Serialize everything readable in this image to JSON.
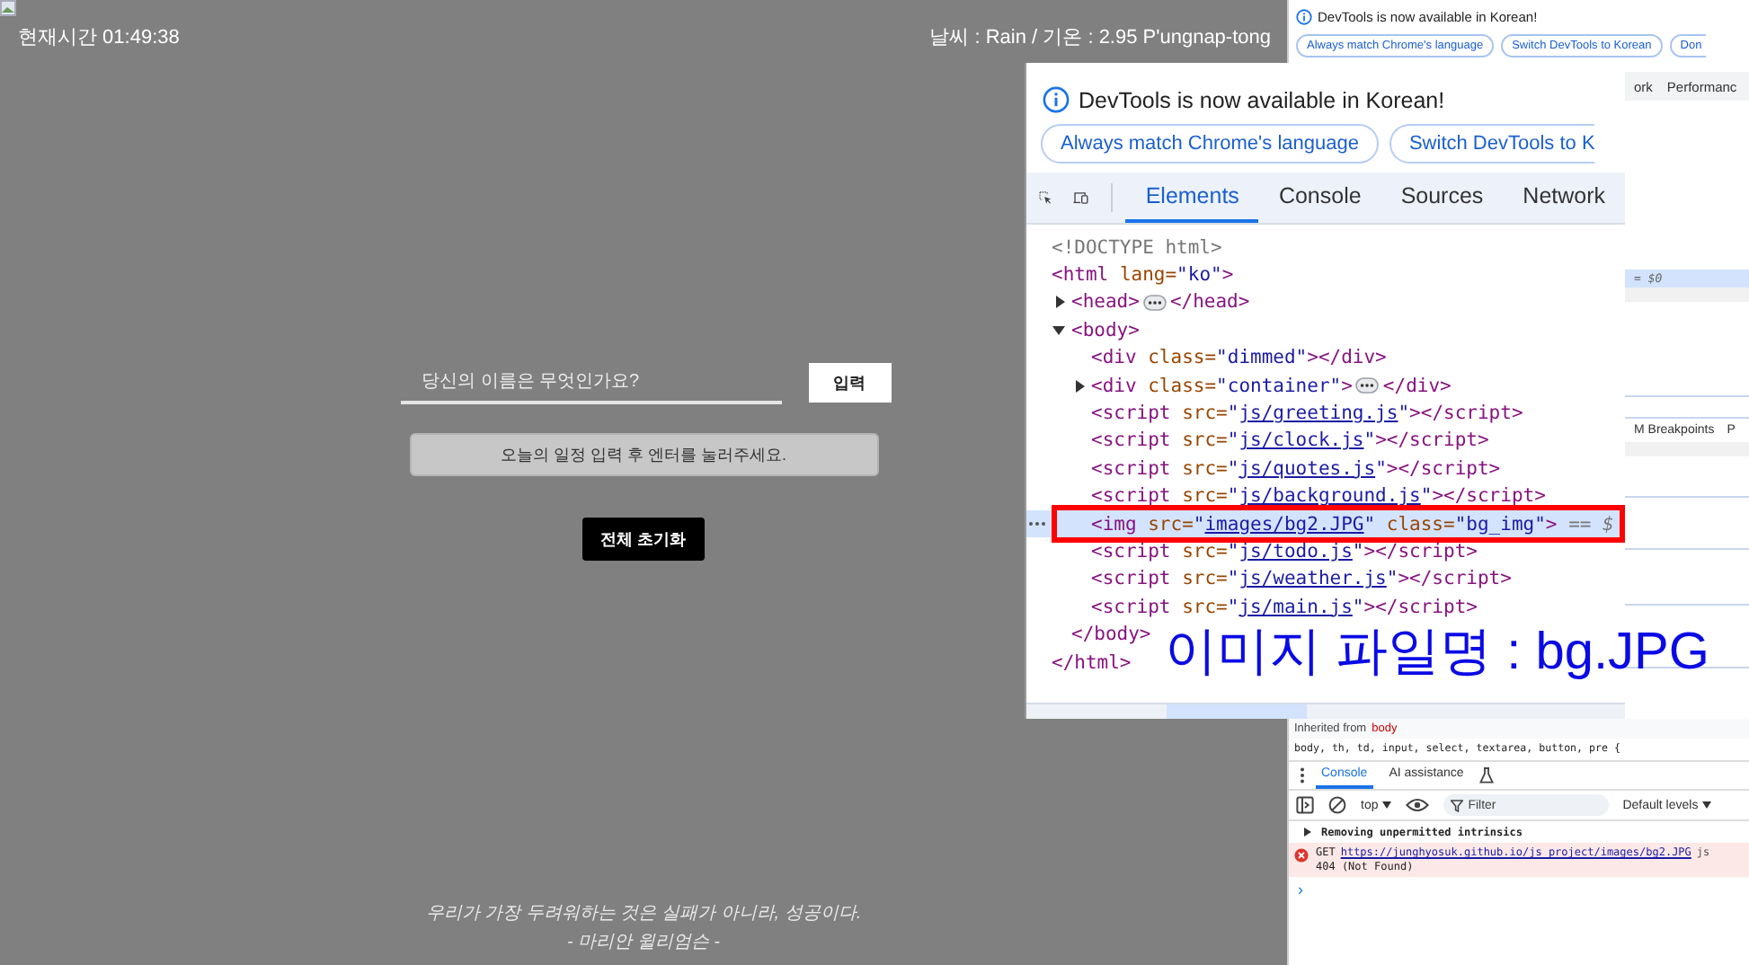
{
  "page": {
    "clock": "현재시간 01:49:38",
    "weather": "날씨 : Rain / 기온 : 2.95 P'ungnap-tong",
    "name_field": {
      "placeholder": "당신의 이름은 무엇인가요?"
    },
    "submit_button": "입력",
    "todo_field": {
      "placeholder": "오늘의 일정 입력 후 엔터를 눌러주세요."
    },
    "reset_button": "전체 초기화",
    "quote": "우리가 가장 두려워하는 것은 실패가 아니라, 성공이다.",
    "author": "- 마리안 윌리엄슨 -"
  },
  "devtools": {
    "banner": "DevTools is now available in Korean!",
    "banner_buttons": [
      "Always match Chrome's language",
      "Switch DevTools to Korean",
      "Don"
    ],
    "tabs": [
      {
        "label": "ork",
        "selected": false
      },
      {
        "label": "Performanc",
        "selected": false
      }
    ],
    "selected_row": "= $0",
    "pane_tabs": [
      "M Breakpoints",
      "P"
    ],
    "inherited_label": "Inherited from",
    "inherited_element": "body",
    "style_rule": "body, th, td, input, select, textarea, button, pre {",
    "drawer_tabs": [
      {
        "label": "Console",
        "selected": true
      },
      {
        "label": "AI assistance",
        "selected": false
      }
    ],
    "context": "top",
    "filter": {
      "placeholder": "Filter"
    },
    "levels": "Default levels",
    "messages": [
      {
        "kind": "info",
        "text": "Removing unpermitted intrinsics"
      },
      {
        "kind": "error",
        "method": "GET",
        "url": "https://junghyosuk.github.io/js_project/images/bg2.JPG",
        "source": "js",
        "status": "404 (Not Found)"
      }
    ],
    "prompt": "›"
  },
  "zoomed_devtools": {
    "banner": "DevTools is now available in Korean!",
    "banner_buttons": [
      "Always match Chrome's language",
      "Switch DevTools to K"
    ],
    "tabs": [
      {
        "label": "Elements",
        "selected": true
      },
      {
        "label": "Console",
        "selected": false
      },
      {
        "label": "Sources",
        "selected": false
      },
      {
        "label": "Network",
        "selected": false
      }
    ],
    "dom": [
      {
        "kind": "leaf",
        "selected": false,
        "tokens": [
          {
            "kind": "comment",
            "text": "<!DOCTYPE html>"
          }
        ]
      },
      {
        "kind": "leaf",
        "selected": false,
        "tokens": [
          {
            "kind": "tag",
            "text": "<html "
          },
          {
            "kind": "attr",
            "text": "lang="
          },
          {
            "kind": "value",
            "text": "\"ko\""
          },
          {
            "kind": "tag",
            "text": ">"
          }
        ],
        "end": [
          {
            "kind": "tag",
            "text": "</html>"
          }
        ],
        "children": [
          {
            "kind": "collapsed",
            "selected": false,
            "tokens": [
              {
                "kind": "tag",
                "text": "<head>"
              },
              {
                "kind": "ellipsis"
              },
              {
                "kind": "tag",
                "text": "</head>"
              }
            ]
          },
          {
            "kind": "expanded",
            "selected": false,
            "tokens": [
              {
                "kind": "tag",
                "text": "<body>"
              }
            ],
            "end": [
              {
                "kind": "tag",
                "text": "</body>"
              }
            ],
            "children": [
              {
                "kind": "leaf",
                "selected": false,
                "tokens": [
                  {
                    "kind": "tag",
                    "text": "<div "
                  },
                  {
                    "kind": "attr",
                    "text": "class="
                  },
                  {
                    "kind": "value",
                    "text": "\"dimmed\""
                  },
                  {
                    "kind": "tag",
                    "text": "></div>"
                  }
                ]
              },
              {
                "kind": "collapsed",
                "selected": false,
                "tokens": [
                  {
                    "kind": "tag",
                    "text": "<div "
                  },
                  {
                    "kind": "attr",
                    "text": "class="
                  },
                  {
                    "kind": "value",
                    "text": "\"container\""
                  },
                  {
                    "kind": "tag",
                    "text": ">"
                  },
                  {
                    "kind": "ellipsis"
                  },
                  {
                    "kind": "tag",
                    "text": "</div>"
                  }
                ]
              },
              {
                "kind": "leaf",
                "selected": false,
                "tokens": [
                  {
                    "kind": "tag",
                    "text": "<script "
                  },
                  {
                    "kind": "attr",
                    "text": "src="
                  },
                  {
                    "kind": "value",
                    "text": "\""
                  },
                  {
                    "kind": "link",
                    "text": "js/greeting.js"
                  },
                  {
                    "kind": "value",
                    "text": "\""
                  },
                  {
                    "kind": "tag",
                    "text": "></script>"
                  }
                ]
              },
              {
                "kind": "leaf",
                "selected": false,
                "tokens": [
                  {
                    "kind": "tag",
                    "text": "<script "
                  },
                  {
                    "kind": "attr",
                    "text": "src="
                  },
                  {
                    "kind": "value",
                    "text": "\""
                  },
                  {
                    "kind": "link",
                    "text": "js/clock.js"
                  },
                  {
                    "kind": "value",
                    "text": "\""
                  },
                  {
                    "kind": "tag",
                    "text": "></script>"
                  }
                ]
              },
              {
                "kind": "leaf",
                "selected": false,
                "tokens": [
                  {
                    "kind": "tag",
                    "text": "<script "
                  },
                  {
                    "kind": "attr",
                    "text": "src="
                  },
                  {
                    "kind": "value",
                    "text": "\""
                  },
                  {
                    "kind": "link",
                    "text": "js/quotes.js"
                  },
                  {
                    "kind": "value",
                    "text": "\""
                  },
                  {
                    "kind": "tag",
                    "text": "></script>"
                  }
                ]
              },
              {
                "kind": "leaf",
                "selected": false,
                "tokens": [
                  {
                    "kind": "tag",
                    "text": "<script "
                  },
                  {
                    "kind": "attr",
                    "text": "src="
                  },
                  {
                    "kind": "value",
                    "text": "\""
                  },
                  {
                    "kind": "link",
                    "text": "js/background.js"
                  },
                  {
                    "kind": "value",
                    "text": "\""
                  },
                  {
                    "kind": "tag",
                    "text": "></script>"
                  }
                ]
              },
              {
                "kind": "leaf",
                "selected": true,
                "tokens": [
                  {
                    "kind": "tag",
                    "text": "<img "
                  },
                  {
                    "kind": "attr",
                    "text": "src="
                  },
                  {
                    "kind": "value",
                    "text": "\""
                  },
                  {
                    "kind": "link",
                    "text": "images/bg2.JPG"
                  },
                  {
                    "kind": "value",
                    "text": "\""
                  },
                  {
                    "kind": "attr",
                    "text": " class="
                  },
                  {
                    "kind": "value",
                    "text": "\"bg_img\""
                  },
                  {
                    "kind": "tag",
                    "text": ">"
                  },
                  {
                    "kind": "marker",
                    "text": " == $"
                  }
                ]
              },
              {
                "kind": "leaf",
                "selected": false,
                "tokens": [
                  {
                    "kind": "tag",
                    "text": "<script "
                  },
                  {
                    "kind": "attr",
                    "text": "src="
                  },
                  {
                    "kind": "value",
                    "text": "\""
                  },
                  {
                    "kind": "link",
                    "text": "js/todo.js"
                  },
                  {
                    "kind": "value",
                    "text": "\""
                  },
                  {
                    "kind": "tag",
                    "text": "></script>"
                  }
                ]
              },
              {
                "kind": "leaf",
                "selected": false,
                "tokens": [
                  {
                    "kind": "tag",
                    "text": "<script "
                  },
                  {
                    "kind": "attr",
                    "text": "src="
                  },
                  {
                    "kind": "value",
                    "text": "\""
                  },
                  {
                    "kind": "link",
                    "text": "js/weather.js"
                  },
                  {
                    "kind": "value",
                    "text": "\""
                  },
                  {
                    "kind": "tag",
                    "text": "></script>"
                  }
                ]
              },
              {
                "kind": "leaf",
                "selected": false,
                "tokens": [
                  {
                    "kind": "tag",
                    "text": "<script "
                  },
                  {
                    "kind": "attr",
                    "text": "src="
                  },
                  {
                    "kind": "value",
                    "text": "\""
                  },
                  {
                    "kind": "link",
                    "text": "js/main.js"
                  },
                  {
                    "kind": "value",
                    "text": "\""
                  },
                  {
                    "kind": "tag",
                    "text": "></script>"
                  }
                ]
              }
            ]
          }
        ]
      }
    ]
  },
  "annotation": "이미지 파일명 : bg.JPG"
}
